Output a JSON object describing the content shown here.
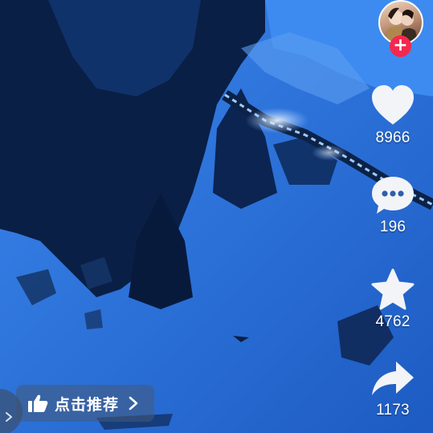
{
  "video": {
    "scene": "snowy-mountain-night-train"
  },
  "creator": {
    "avatar_icon": "creator-avatar",
    "follow_symbol": "+"
  },
  "actions": {
    "like": {
      "icon": "heart-icon",
      "count": "8966"
    },
    "comment": {
      "icon": "comment-bubble-icon",
      "count": "196"
    },
    "favorite": {
      "icon": "star-icon",
      "count": "4762"
    },
    "share": {
      "icon": "share-arrow-icon",
      "count": "1173"
    }
  },
  "recommend": {
    "label": "点击推荐",
    "icon": "thumbs-up-icon",
    "chevron_icon": "chevron-right-icon"
  },
  "colors": {
    "follow_button": "#f5284d",
    "snow_blue": "#2f76e0",
    "night_blue": "#0b2f6e"
  }
}
